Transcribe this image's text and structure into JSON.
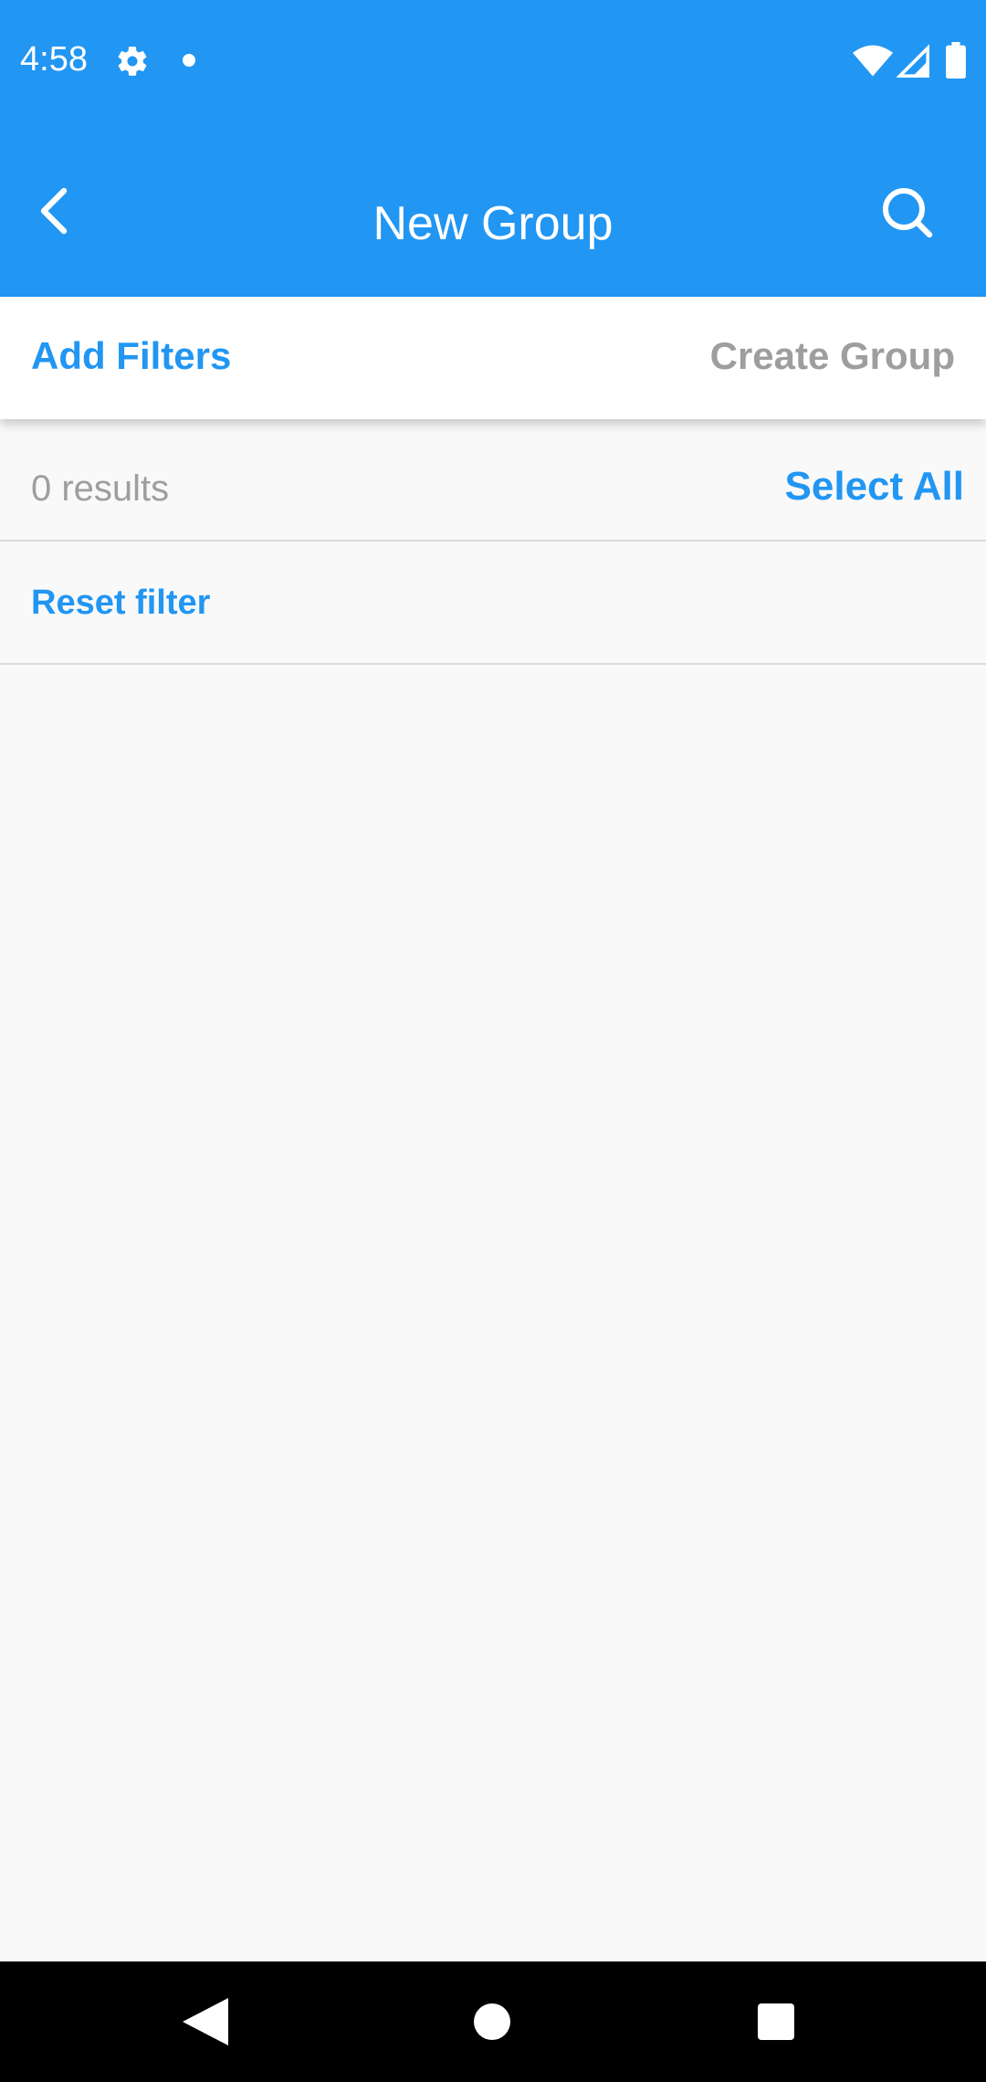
{
  "status_bar": {
    "time": "4:58",
    "icons": [
      "gear-icon",
      "notification-dot-icon",
      "wifi-icon",
      "signal-icon",
      "battery-icon"
    ]
  },
  "app_bar": {
    "title": "New Group",
    "back_icon": "chevron-left-icon",
    "search_icon": "search-icon",
    "background_color": "#2196f3"
  },
  "actions": {
    "add_filters_label": "Add Filters",
    "create_group_label": "Create Group"
  },
  "results": {
    "count_text": "0 results",
    "select_all_label": "Select All"
  },
  "filter": {
    "reset_label": "Reset filter"
  },
  "nav_bar": {
    "icons": [
      "back-triangle-icon",
      "home-circle-icon",
      "recents-square-icon"
    ]
  },
  "colors": {
    "accent": "#2196f3",
    "disabled_text": "#9e9e9e",
    "background": "#f9f9f9"
  }
}
